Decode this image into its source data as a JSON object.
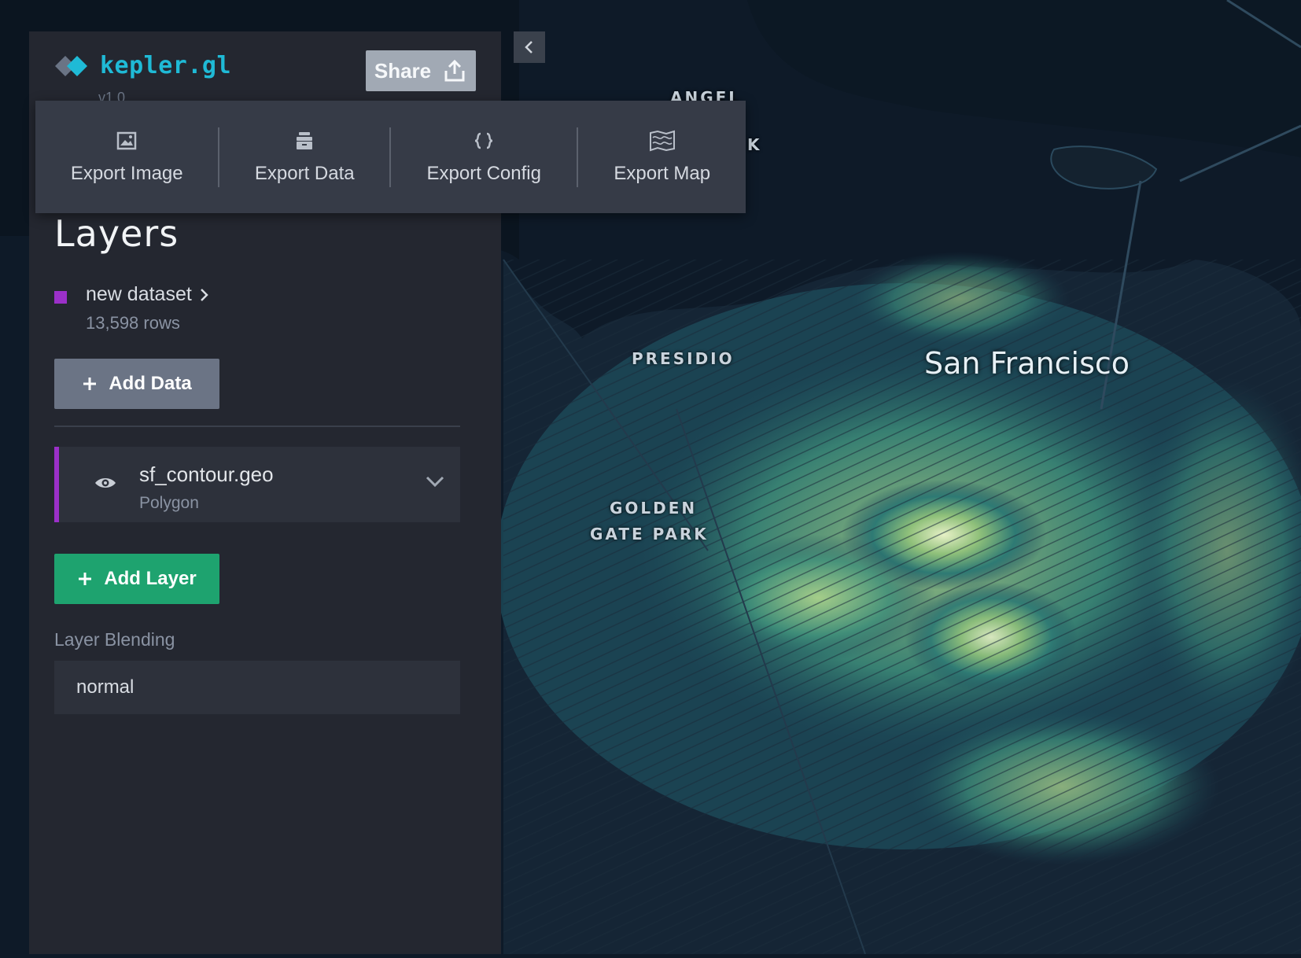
{
  "app": {
    "logo_text": "kepler.gl",
    "version": "v1.0",
    "share_label": "Share",
    "accent": "#1fbad6"
  },
  "export_menu": {
    "items": [
      {
        "label": "Export Image",
        "icon": "image-icon"
      },
      {
        "label": "Export Data",
        "icon": "database-icon"
      },
      {
        "label": "Export Config",
        "icon": "code-braces-icon"
      },
      {
        "label": "Export Map",
        "icon": "map-icon"
      }
    ]
  },
  "layers_panel": {
    "title": "Layers",
    "dataset": {
      "name": "new dataset",
      "rows": "13,598 rows",
      "color": "#9b30c8"
    },
    "add_data_label": "Add Data",
    "layer": {
      "name": "sf_contour.geo",
      "type": "Polygon"
    },
    "add_layer_label": "Add Layer",
    "blending_label": "Layer Blending",
    "blending_value": "normal"
  },
  "map": {
    "city_label": "San Francisco",
    "place_labels": [
      "ANGEL",
      "K",
      "PRESIDIO",
      "GOLDEN",
      "GATE PARK"
    ]
  },
  "colors": {
    "panel_bg": "#242730",
    "add_layer_green": "#1ea36f",
    "map_bg": "#0e1a28"
  }
}
